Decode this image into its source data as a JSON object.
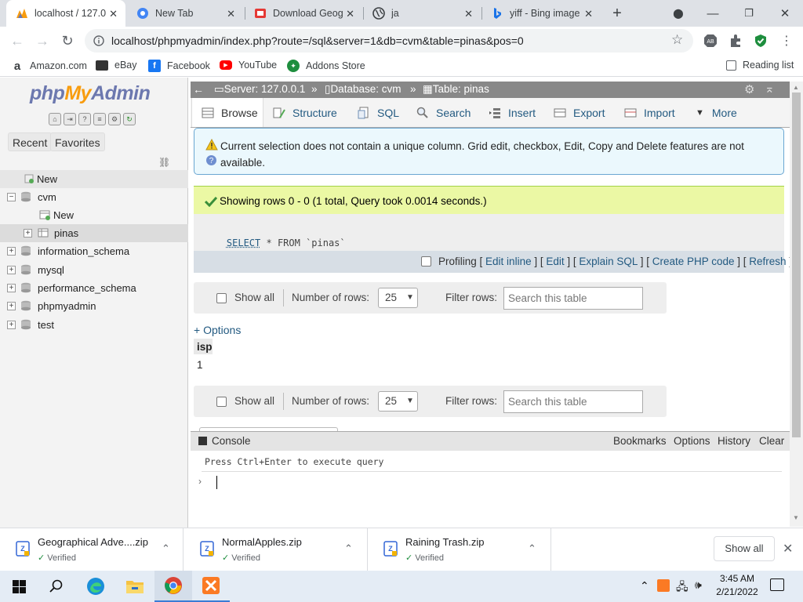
{
  "browser": {
    "tabs": [
      {
        "title": "localhost / 127.0",
        "active": true
      },
      {
        "title": "New Tab"
      },
      {
        "title": "Download Geog"
      },
      {
        "title": "ja"
      },
      {
        "title": "yiff - Bing image"
      }
    ],
    "url": "localhost/phpmyadmin/index.php?route=/sql&server=1&db=cvm&table=pinas&pos=0",
    "bookmarks": [
      "Amazon.com",
      "eBay",
      "Facebook",
      "YouTube",
      "Addons Store"
    ],
    "reading_list": "Reading list"
  },
  "nav": {
    "logo": {
      "php": "php",
      "my": "My",
      "admin": "Admin"
    },
    "tabs": [
      "Recent",
      "Favorites"
    ],
    "tree": {
      "new_root": "New",
      "cvm": "cvm",
      "cvm_new": "New",
      "pinas": "pinas",
      "dbs": [
        "information_schema",
        "mysql",
        "performance_schema",
        "phpmyadmin",
        "test"
      ]
    }
  },
  "breadcrumb": {
    "server": "Server: 127.0.0.1",
    "database": "Database: cvm",
    "table": "Table: pinas"
  },
  "tabs": [
    "Browse",
    "Structure",
    "SQL",
    "Search",
    "Insert",
    "Export",
    "Import",
    "More"
  ],
  "notice": "Current selection does not contain a unique column. Grid edit, checkbox, Edit, Copy and Delete features are not available.",
  "success": "Showing rows 0 - 0 (1 total, Query took 0.0014 seconds.)",
  "sql": {
    "select": "SELECT",
    "rest": " * FROM `pinas`"
  },
  "sql_actions": {
    "profiling": "Profiling",
    "links": [
      "Edit inline",
      "Edit",
      "Explain SQL",
      "Create PHP code",
      "Refresh"
    ]
  },
  "table_nav": {
    "show_all": "Show all",
    "number_of_rows": "Number of rows:",
    "rows_value": "25",
    "filter_rows": "Filter rows:",
    "search_placeholder": "Search this table"
  },
  "options_link": "+ Options",
  "result": {
    "column": "isp",
    "rows": [
      "1"
    ]
  },
  "console": {
    "title": "Console",
    "links": [
      "Bookmarks",
      "Options",
      "History",
      "Clear"
    ],
    "hint": "Press Ctrl+Enter to execute query"
  },
  "downloads": [
    {
      "name": "Geographical Adve....zip",
      "status": "Verified"
    },
    {
      "name": "NormalApples.zip",
      "status": "Verified"
    },
    {
      "name": "Raining Trash.zip",
      "status": "Verified"
    }
  ],
  "downloads_show_all": "Show all",
  "clock": {
    "time": "3:45 AM",
    "date": "2/21/2022"
  }
}
